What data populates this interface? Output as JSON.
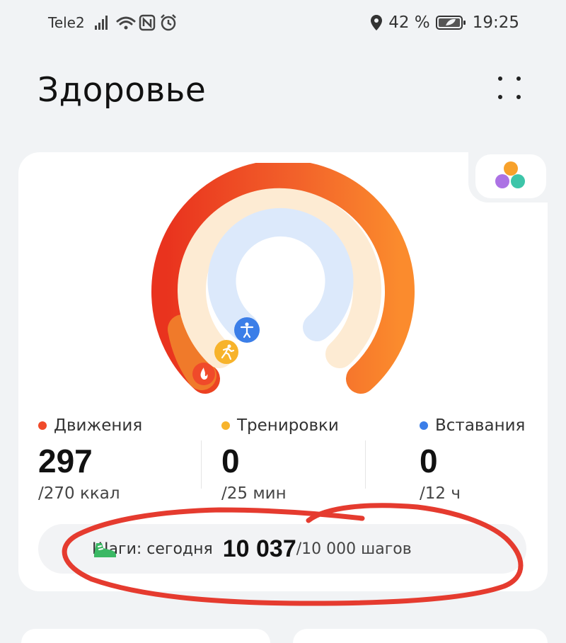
{
  "status_bar": {
    "carrier": "Tele2",
    "battery_percent": "42 %",
    "time": "19:25",
    "icons": [
      "signal-icon",
      "wifi-icon",
      "nfc-icon",
      "alarm-icon",
      "location-icon",
      "battery-icon"
    ]
  },
  "header": {
    "title": "Здоровье",
    "menu_icon": "grid-dots-icon"
  },
  "activity_rings": {
    "move": {
      "label": "Движения",
      "value": "297",
      "target": "/270 ккал",
      "color": "#f04a2a",
      "progress": 1.1
    },
    "exercise": {
      "label": "Тренировки",
      "value": "0",
      "target": "/25 мин",
      "color": "#f7b32b",
      "progress": 0
    },
    "stand": {
      "label": "Вставания",
      "value": "0",
      "target": "/12 ч",
      "color": "#3b7ee8",
      "progress": 0
    }
  },
  "steps": {
    "label": "Шаги: сегодня",
    "value": "10 037",
    "goal": "/10 000 шагов",
    "icon": "shoe-icon",
    "icon_color": "#3bb864"
  },
  "annotation_color": "#e53b2f"
}
